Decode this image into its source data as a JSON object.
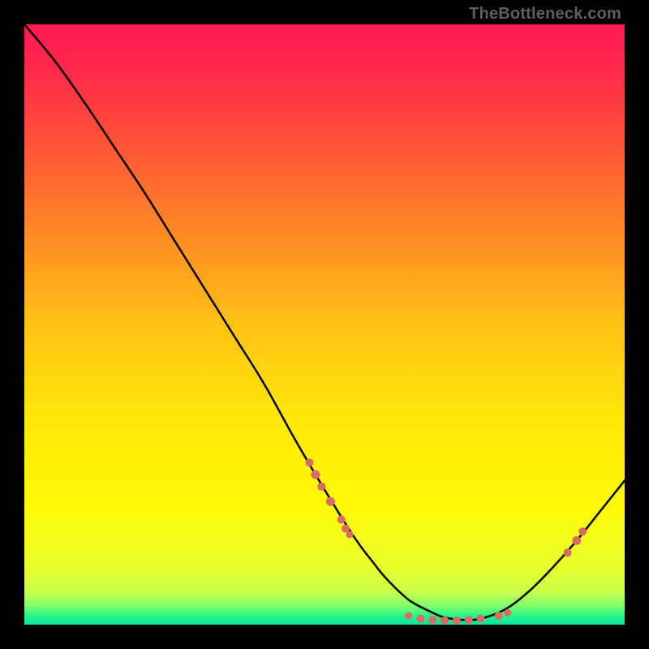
{
  "watermark": "TheBottleneck.com",
  "chart_data": {
    "type": "line",
    "title": "",
    "xlabel": "",
    "ylabel": "",
    "xlim": [
      0,
      100
    ],
    "ylim": [
      0,
      100
    ],
    "grid": false,
    "legend": false,
    "gradient_stops": [
      {
        "offset": 0.0,
        "color": "#ff1a52"
      },
      {
        "offset": 0.08,
        "color": "#ff2a4a"
      },
      {
        "offset": 0.2,
        "color": "#ff5438"
      },
      {
        "offset": 0.35,
        "color": "#ff8a25"
      },
      {
        "offset": 0.5,
        "color": "#ffc215"
      },
      {
        "offset": 0.65,
        "color": "#ffe60a"
      },
      {
        "offset": 0.8,
        "color": "#fff905"
      },
      {
        "offset": 0.9,
        "color": "#eaff2a"
      },
      {
        "offset": 0.945,
        "color": "#c9ff4a"
      },
      {
        "offset": 0.97,
        "color": "#7aff6e"
      },
      {
        "offset": 0.985,
        "color": "#27f58a"
      },
      {
        "offset": 1.0,
        "color": "#0ee39a"
      }
    ],
    "series": [
      {
        "name": "bottleneck-curve",
        "stroke": "#000000",
        "x": [
          0,
          5,
          10,
          15,
          20,
          25,
          30,
          35,
          40,
          45,
          50,
          55,
          58,
          60,
          63,
          65,
          68,
          70,
          73,
          76,
          80,
          84,
          88,
          92,
          96,
          100
        ],
        "y": [
          100,
          94,
          87,
          79.5,
          72,
          64,
          56,
          48,
          40,
          31,
          22.5,
          14.5,
          10.5,
          8,
          5,
          3.5,
          2,
          1.2,
          0.8,
          1.0,
          2.5,
          5.5,
          9.5,
          14,
          19,
          24
        ]
      }
    ],
    "clusters": [
      {
        "name": "left-cluster",
        "color": "#d86b64",
        "points": [
          {
            "x": 47.5,
            "y": 27.0,
            "r": 5.0
          },
          {
            "x": 48.5,
            "y": 25.0,
            "r": 5.5
          },
          {
            "x": 49.5,
            "y": 23.0,
            "r": 5.0
          },
          {
            "x": 51.0,
            "y": 20.5,
            "r": 5.5
          },
          {
            "x": 52.8,
            "y": 17.5,
            "r": 5.0
          },
          {
            "x": 53.5,
            "y": 16.0,
            "r": 5.0
          },
          {
            "x": 54.2,
            "y": 15.0,
            "r": 4.5
          }
        ]
      },
      {
        "name": "bottom-cluster",
        "color": "#d86b64",
        "points": [
          {
            "x": 64.0,
            "y": 1.5,
            "r": 4.5
          },
          {
            "x": 66.0,
            "y": 1.0,
            "r": 5.0
          },
          {
            "x": 68.0,
            "y": 0.8,
            "r": 5.0
          },
          {
            "x": 70.0,
            "y": 0.7,
            "r": 5.0
          },
          {
            "x": 72.0,
            "y": 0.7,
            "r": 5.0
          },
          {
            "x": 74.0,
            "y": 0.8,
            "r": 5.0
          },
          {
            "x": 76.0,
            "y": 1.0,
            "r": 5.0
          },
          {
            "x": 79.0,
            "y": 1.5,
            "r": 5.0
          },
          {
            "x": 80.5,
            "y": 2.0,
            "r": 4.5
          }
        ]
      },
      {
        "name": "right-cluster",
        "color": "#d86b64",
        "points": [
          {
            "x": 90.5,
            "y": 12.0,
            "r": 5.0
          },
          {
            "x": 92.0,
            "y": 14.0,
            "r": 5.5
          },
          {
            "x": 93.0,
            "y": 15.5,
            "r": 5.0
          }
        ]
      }
    ]
  }
}
